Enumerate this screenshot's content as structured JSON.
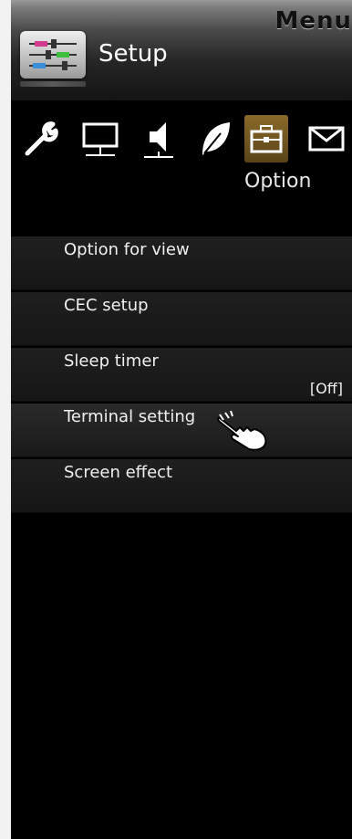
{
  "header": {
    "menu_title": "Menu",
    "section_title": "Setup",
    "section_icon": "sliders-icon"
  },
  "categories": [
    {
      "name": "wrench-icon",
      "active": false
    },
    {
      "name": "monitor-icon",
      "active": false
    },
    {
      "name": "speaker-icon",
      "active": false
    },
    {
      "name": "leaf-icon",
      "active": false
    },
    {
      "name": "toolbox-icon",
      "active": true
    },
    {
      "name": "envelope-icon",
      "active": false
    }
  ],
  "active_category_label": "Option",
  "menu_items": [
    {
      "label": "Option for view",
      "value": ""
    },
    {
      "label": "CEC setup",
      "value": ""
    },
    {
      "label": "Sleep timer",
      "value": "[Off]"
    },
    {
      "label": "Terminal setting",
      "value": ""
    },
    {
      "label": "Screen effect",
      "value": ""
    }
  ],
  "colors": {
    "accent": "#8a6a2a",
    "panel_bg": "#000000",
    "item_bg": "#1c1c1c",
    "text": "#f0f0f0"
  }
}
